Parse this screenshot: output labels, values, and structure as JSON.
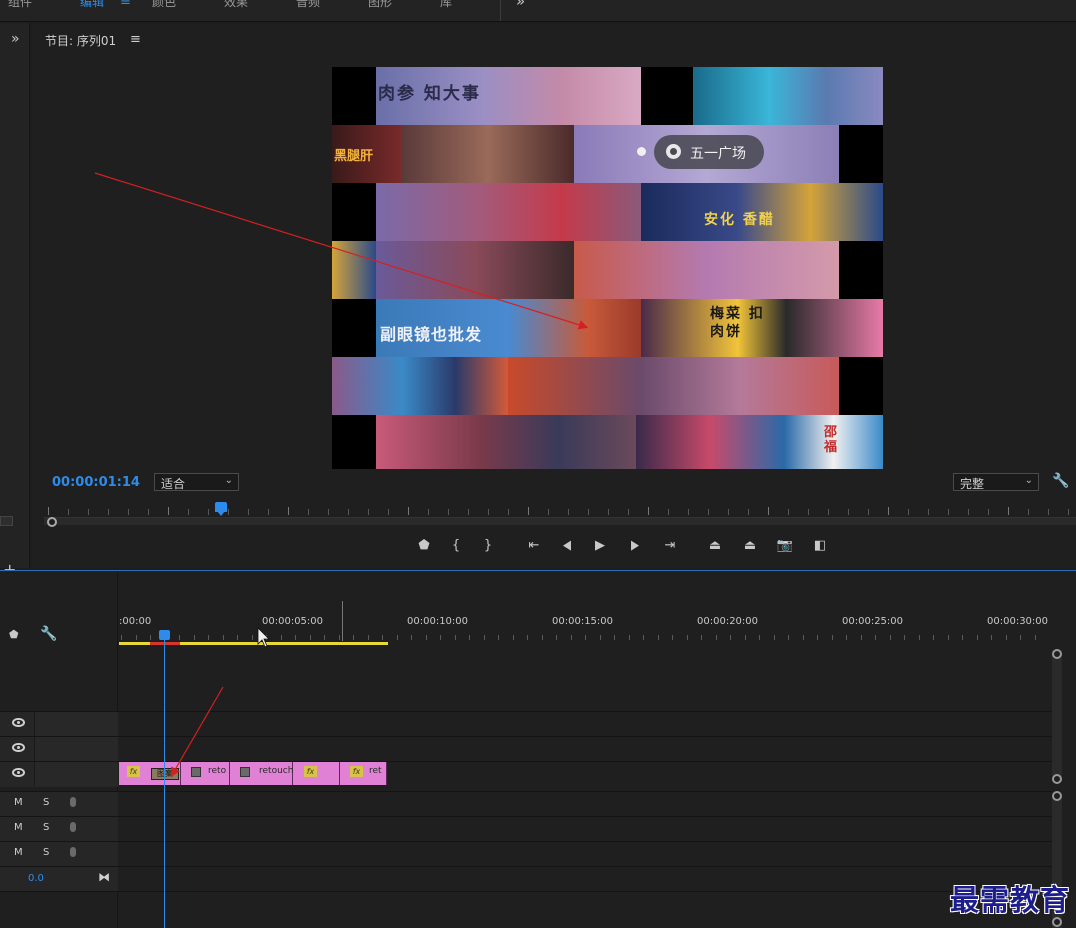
{
  "workspace_tabs": [
    {
      "label": "组件",
      "active": false
    },
    {
      "label": "编辑",
      "active": true
    },
    {
      "label": "颜色",
      "active": false
    },
    {
      "label": "效果",
      "active": false
    },
    {
      "label": "音频",
      "active": false
    },
    {
      "label": "图形",
      "active": false
    },
    {
      "label": "库",
      "active": false
    }
  ],
  "icons": {
    "workspace_menu": "≡",
    "workspace_overflow": "»",
    "panel_expand": "»",
    "add": "+",
    "panel_menu": "≡",
    "wrench": "🔧",
    "marker": "⬟",
    "bowtie": "⧓"
  },
  "program_monitor": {
    "title": "节目: 序列01",
    "timecode": "00:00:01:14",
    "fit_dropdown": "适合",
    "quality_dropdown": "完整",
    "preview": {
      "location_tag": "五一广场",
      "signs": [
        "肉参 知大事",
        "黑腿肝",
        "安化 香醋",
        "副眼镜也批发",
        "梅菜 扣肉饼",
        "邵福"
      ]
    }
  },
  "transport": [
    {
      "name": "add-marker-button",
      "glyph": "⬟"
    },
    {
      "name": "mark-in-button",
      "glyph": "{"
    },
    {
      "name": "mark-out-button",
      "glyph": "}"
    },
    {
      "name": "go-to-in-button",
      "glyph": "⇤"
    },
    {
      "name": "step-back-button",
      "glyph": "◀"
    },
    {
      "name": "play-button",
      "glyph": "▶"
    },
    {
      "name": "step-forward-button",
      "glyph": "▶"
    },
    {
      "name": "go-to-out-button",
      "glyph": "⇥"
    },
    {
      "name": "lift-button",
      "glyph": "⏏"
    },
    {
      "name": "extract-button",
      "glyph": "⏏"
    },
    {
      "name": "export-frame-button",
      "glyph": "📷"
    },
    {
      "name": "comparison-view-button",
      "glyph": "◧"
    }
  ],
  "timeline": {
    "ruler_labels": [
      ":00:00",
      "00:00:05:00",
      "00:00:10:00",
      "00:00:15:00",
      "00:00:20:00",
      "00:00:25:00",
      "00:00:30:00"
    ],
    "video_tracks": 3,
    "audio_tracks": [
      {
        "mute": "M",
        "solo": "S"
      },
      {
        "mute": "M",
        "solo": "S"
      },
      {
        "mute": "M",
        "solo": "S"
      }
    ],
    "master_volume": "0.0",
    "clips": [
      {
        "label": "",
        "has_fx": true
      },
      {
        "label": "reto",
        "has_fx": true
      },
      {
        "label": "retouch",
        "has_fx": true
      },
      {
        "label": "",
        "has_fx": true
      },
      {
        "label": "ret",
        "has_fx": true
      }
    ],
    "overlay_clip_text": "图案"
  },
  "watermark": "最需教育",
  "colors": {
    "accent": "#2d8ceb",
    "clip": "#e081d6",
    "work_area": "#e8d93a",
    "annotation": "#d42020"
  }
}
